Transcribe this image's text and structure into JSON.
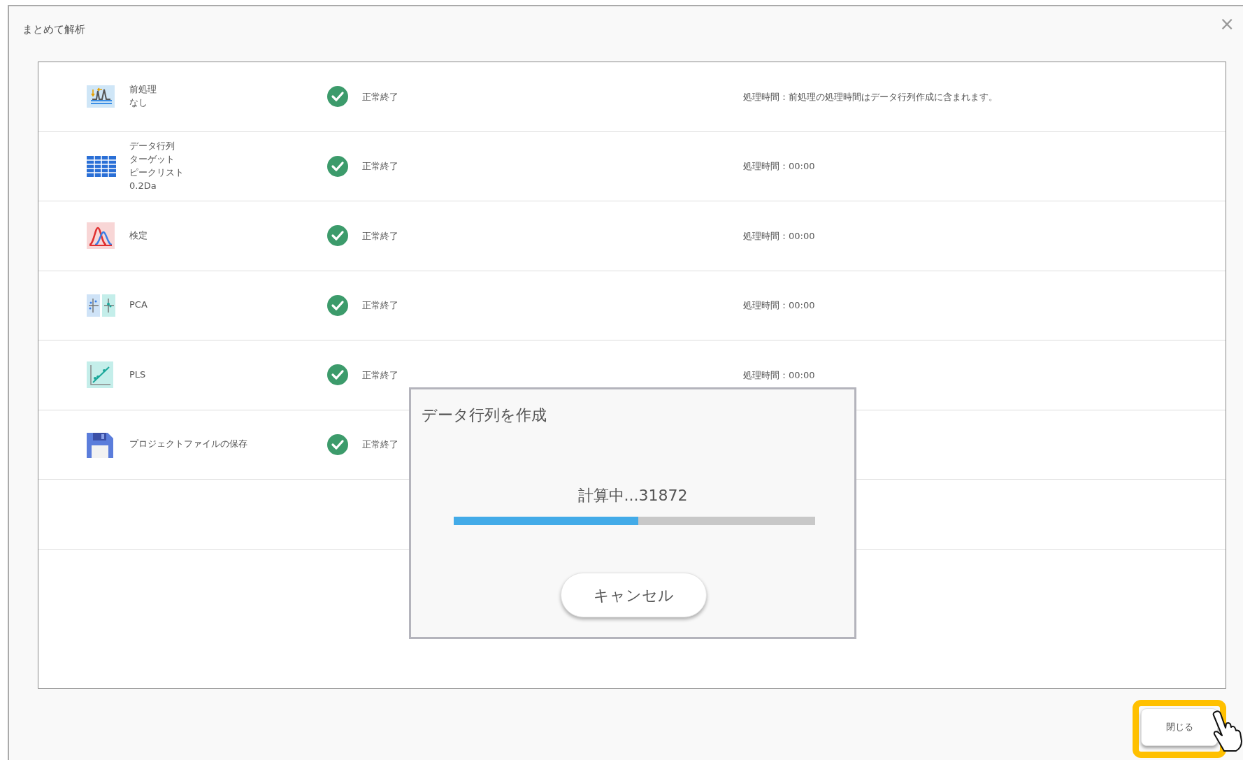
{
  "window": {
    "title": "まとめて解析",
    "close": "×"
  },
  "rows": [
    {
      "label": [
        "前処理",
        "なし"
      ],
      "completed": true,
      "status": "正常終了",
      "time": "処理時間：前処理の処理時間はデータ行列作成に含まれます。"
    },
    {
      "label": [
        "データ行列",
        "ターゲット",
        "ピークリスト",
        "0.2Da"
      ],
      "completed": true,
      "status": "正常終了",
      "time": "処理時間：00:00"
    },
    {
      "label": [
        "検定"
      ],
      "completed": true,
      "status": "正常終了",
      "time": "処理時間：00:00"
    },
    {
      "label": [
        "PCA"
      ],
      "completed": true,
      "status": "正常終了",
      "time": "処理時間：00:00"
    },
    {
      "label": [
        "PLS"
      ],
      "completed": true,
      "status": "正常終了",
      "time": "処理時間：00:00"
    },
    {
      "label": [
        "プロジェクトファイルの保存"
      ],
      "completed": true,
      "status": "正常終了"
    }
  ],
  "progress_dialog": {
    "title": "データ行列を作成",
    "message": "計算中...31872",
    "level": 0.51,
    "cancel": "キャンセル"
  },
  "close_button": {
    "label": "閉じる",
    "highlighted": true
  }
}
